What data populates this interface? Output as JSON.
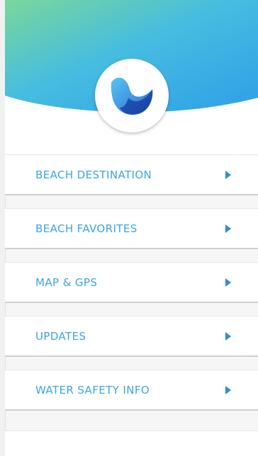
{
  "app": {
    "logo_icon": "wave-logo-icon",
    "colors": {
      "header_gradient_start": "#6fd39a",
      "header_gradient_mid": "#43b8e4",
      "header_gradient_end": "#2f9fe6",
      "label_text": "#3aa6e0",
      "arrow": "#2c8fd6"
    }
  },
  "menu": {
    "items": [
      {
        "label": "BEACH DESTINATION",
        "icon": "chevron-right-icon"
      },
      {
        "label": "BEACH FAVORITES",
        "icon": "chevron-right-icon"
      },
      {
        "label": "MAP & GPS",
        "icon": "chevron-right-icon"
      },
      {
        "label": "UPDATES",
        "icon": "chevron-right-icon"
      },
      {
        "label": "WATER SAFETY INFO",
        "icon": "chevron-right-icon"
      }
    ]
  }
}
